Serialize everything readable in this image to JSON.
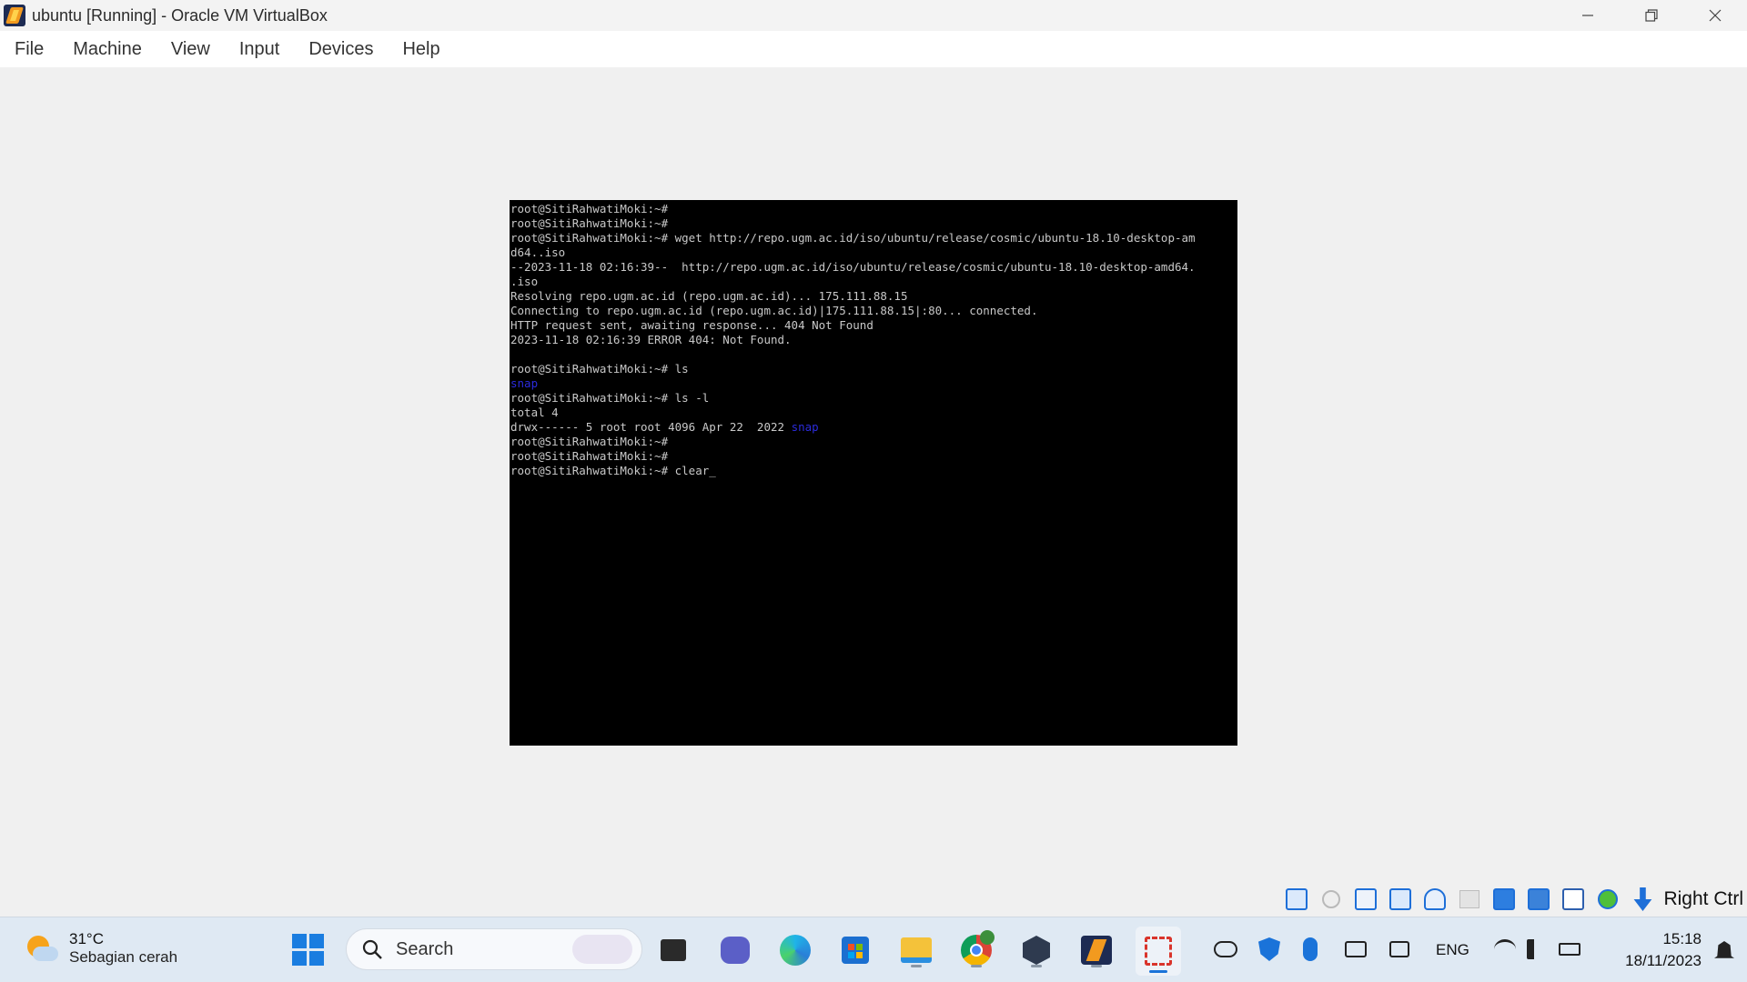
{
  "window": {
    "title": "ubuntu [Running] - Oracle VM VirtualBox"
  },
  "menu": {
    "items": [
      "File",
      "Machine",
      "View",
      "Input",
      "Devices",
      "Help"
    ]
  },
  "terminal": {
    "lines": [
      {
        "text": "root@SitiRahwatiMoki:~#"
      },
      {
        "text": "root@SitiRahwatiMoki:~#"
      },
      {
        "text": "root@SitiRahwatiMoki:~# wget http://repo.ugm.ac.id/iso/ubuntu/release/cosmic/ubuntu-18.10-desktop-am"
      },
      {
        "text": "d64..iso"
      },
      {
        "text": "--2023-11-18 02:16:39--  http://repo.ugm.ac.id/iso/ubuntu/release/cosmic/ubuntu-18.10-desktop-amd64."
      },
      {
        "text": ".iso"
      },
      {
        "text": "Resolving repo.ugm.ac.id (repo.ugm.ac.id)... 175.111.88.15"
      },
      {
        "text": "Connecting to repo.ugm.ac.id (repo.ugm.ac.id)|175.111.88.15|:80... connected."
      },
      {
        "text": "HTTP request sent, awaiting response... 404 Not Found"
      },
      {
        "text": "2023-11-18 02:16:39 ERROR 404: Not Found."
      },
      {
        "text": ""
      },
      {
        "text": "root@SitiRahwatiMoki:~# ls"
      },
      {
        "text": "snap",
        "color": "blue"
      },
      {
        "text": "root@SitiRahwatiMoki:~# ls -l"
      },
      {
        "text": "total 4"
      },
      {
        "text": "drwx------ 5 root root 4096 Apr 22  2022 ",
        "suffix": "snap"
      },
      {
        "text": "root@SitiRahwatiMoki:~#"
      },
      {
        "text": "root@SitiRahwatiMoki:~#"
      },
      {
        "text": "root@SitiRahwatiMoki:~# clear",
        "cursor": "_"
      }
    ]
  },
  "vbox_status": {
    "host_key": "Right Ctrl"
  },
  "taskbar": {
    "weather_temp": "31°C",
    "weather_desc": "Sebagian cerah",
    "search_placeholder": "Search",
    "language": "ENG",
    "time": "15:18",
    "date": "18/11/2023"
  },
  "colors": {
    "terminal_bg": "#000000",
    "terminal_fg": "#c8c8c8",
    "terminal_blue": "#2b2bdc",
    "taskbar_bg": "#dfe9f3"
  }
}
